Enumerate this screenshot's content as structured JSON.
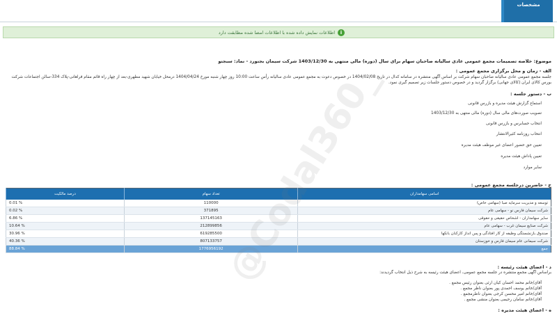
{
  "header": {
    "tab_label": "مشخصات"
  },
  "notice": {
    "text": "اطلاعات نمایش داده شده با اطلاعات امضا شده مطابقت دارد",
    "icon": "info-icon",
    "color": "#3c763d"
  },
  "subject": "موضوع: خلاصه تصمیمات مجمع عمومی عادی سالیانه صاحبان سهام برای سال (دوره) مالی منتهی به 1403/12/30 شرکت سیمان بجنورد - نماد: سبجنو",
  "section_a": {
    "title": "الف - زمان و محل برگزاری مجمع عمومی :",
    "text": "جلسه مجمع عمومی عادی سالیانه صاحبان سهام شرکت بر اساس آگهی منتشره در سامانه کدال در تاریخ 1404/02/08 در خصوص دعوت به مجمع عمومی عادی سالیانه رأس ساعت 10:00 روز چهار شنبه مورخ 1404/04/24 درمحل خیابان شهید مطهری-بعد از چهار راه قائم مقام فراهانی-پلاک 334-سالن اجتماعات شرکت بورس کالای ایران (کالای جهانی) برگزار گردید و در خصوص دستور جلسات زیر تصمیم گیری نمود."
  },
  "section_b": {
    "title": "ب - دستور جلسه :",
    "items": [
      "استماع گزارش هیئت مدیره و بازرس قانونی",
      "تصویب صورت‌های مالی سال (دوره) مالی منتهی به 1403/12/30",
      "انتخاب حسابرس و بازرس قانونی",
      "انتخاب روزنامه کثیرالانتشار",
      "تعیین حق حضور اعضای غیر موظف هیئت مدیره",
      "تعیین پاداش هیئت مدیره",
      "سایر موارد"
    ]
  },
  "section_c": {
    "title": "ج - حاضرین درجلسه مجمع عمومی :",
    "columns": [
      "اسامی سهامداران",
      "تعداد سهام",
      "درصد مالکیت"
    ],
    "rows": [
      {
        "name": "توسعه و مدیریت سرمایه صبا (سهامی خاص)",
        "shares": "110000",
        "percent": "% 0.01"
      },
      {
        "name": "شرکت سیمان فارس نو - سهامی عام",
        "shares": "371895",
        "percent": "% 0.02"
      },
      {
        "name": "سایر سهامداران - اشخاص حقیقی و حقوقی",
        "shares": "137145163",
        "percent": "% 6.86"
      },
      {
        "name": "شرکت صنایع سیمان غرب - سهامی عام",
        "shares": "212899856",
        "percent": "% 10.64"
      },
      {
        "name": "صندوق بازنشستگی وظیفه از کار افتادگی و پس انداز کارکنان بانکها",
        "shares": "619285500",
        "percent": "% 30.96"
      },
      {
        "name": "شرکت سیمانی عام سیمان فارس و خوزستان",
        "shares": "807133757",
        "percent": "% 40.36"
      }
    ],
    "total": {
      "name": "جمع",
      "shares": "1776956192",
      "percent": "% 88.84"
    }
  },
  "section_d": {
    "title": "د - اعضای هیئت رئیسه :",
    "intro": "براساس آگهی مجمع منتشره در جلسه مجمع عمومی، اعضای هیئت رئیسه به شرح ذیل انتخاب گردیدند:",
    "members": [
      "آقای/خانم  محمد احسان کیان ارثی  بعنوان رئیس مجمع .",
      "آقای/خانم  یوسف احمدی پور  بعنوان ناظر مجمع .",
      "آقای/خانم  امیر محسن کرجی  بعنوان ناظرمجمع .",
      "آقای/خانم  سامان رحیمی  بعنوان منشی مجمع ."
    ]
  },
  "section_e": {
    "title": "ه - اعضای هیئت مدیره :"
  },
  "watermark": "@Codal360_"
}
